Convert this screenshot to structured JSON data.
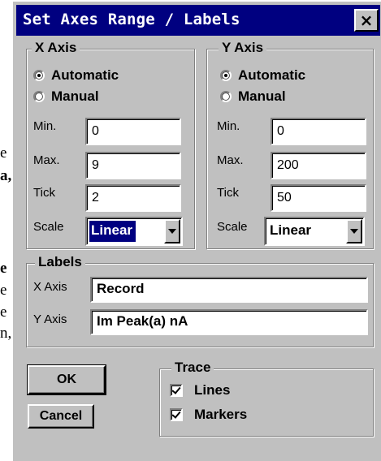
{
  "background_fragments": [
    "e",
    "a,",
    "e",
    "e",
    "e",
    "n,"
  ],
  "dialog": {
    "title": "Set Axes Range / Labels",
    "close_glyph": "×"
  },
  "x_axis": {
    "legend": "X Axis",
    "radio_automatic": "Automatic",
    "radio_manual": "Manual",
    "selected_mode": "Automatic",
    "min_label": "Min.",
    "min_value": "0",
    "max_label": "Max.",
    "max_value": "9",
    "tick_label": "Tick",
    "tick_value": "2",
    "scale_label": "Scale",
    "scale_value": "Linear"
  },
  "y_axis": {
    "legend": "Y Axis",
    "radio_automatic": "Automatic",
    "radio_manual": "Manual",
    "selected_mode": "Automatic",
    "min_label": "Min.",
    "min_value": "0",
    "max_label": "Max.",
    "max_value": "200",
    "tick_label": "Tick",
    "tick_value": "50",
    "scale_label": "Scale",
    "scale_value": "Linear"
  },
  "labels": {
    "legend": "Labels",
    "x_label": "X Axis",
    "x_value": "Record",
    "y_label": "Y Axis",
    "y_value": "Im Peak(a) nA"
  },
  "buttons": {
    "ok": "OK",
    "cancel": "Cancel"
  },
  "trace": {
    "legend": "Trace",
    "lines_label": "Lines",
    "lines_checked": true,
    "markers_label": "Markers",
    "markers_checked": true
  },
  "colors": {
    "titlebar": "#000080",
    "dialog_face": "#c0c0c0",
    "selection": "#000080"
  }
}
